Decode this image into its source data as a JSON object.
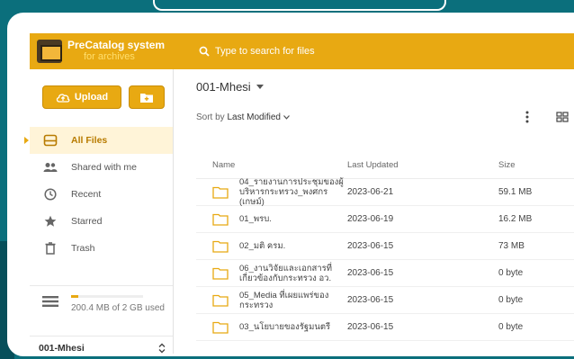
{
  "app": {
    "logo_title": "PreCatalog system",
    "logo_subtitle": "for archives",
    "search_placeholder": "Type to search for files"
  },
  "sidebar": {
    "upload_label": "Upload",
    "items": [
      {
        "label": "All Files",
        "icon": "drive-icon",
        "active": true
      },
      {
        "label": "Shared with me",
        "icon": "people-icon"
      },
      {
        "label": "Recent",
        "icon": "clock-icon"
      },
      {
        "label": "Starred",
        "icon": "star-icon"
      },
      {
        "label": "Trash",
        "icon": "trash-icon"
      }
    ],
    "storage": {
      "text": "200.4 MB of 2 GB used",
      "used_fraction": 0.1
    },
    "workspace": "001-Mhesi"
  },
  "main": {
    "breadcrumb": "001-Mhesi",
    "sort_prefix": "Sort by ",
    "sort_value": "Last Modified",
    "columns": {
      "name": "Name",
      "updated": "Last Updated",
      "size": "Size"
    },
    "files": [
      {
        "name": "04_รายงานการประชุมของผู้บริหารกระทรวง_พงศกร (เกษม์)",
        "date": "2023-06-21",
        "size": "59.1 MB"
      },
      {
        "name": "01_พรบ.",
        "date": "2023-06-19",
        "size": "16.2 MB"
      },
      {
        "name": "02_มติ ครม.",
        "date": "2023-06-15",
        "size": "73 MB"
      },
      {
        "name": "06_งานวิจัยและเอกสารที่เกี่ยวข้องกับกระทรวง อว.",
        "date": "2023-06-15",
        "size": "0 byte"
      },
      {
        "name": "05_Media ที่เผยแพร่ของกระทรวง",
        "date": "2023-06-15",
        "size": "0 byte"
      },
      {
        "name": "03_นโยบายของรัฐมนตรี",
        "date": "2023-06-15",
        "size": "0 byte"
      }
    ]
  },
  "colors": {
    "accent": "#e8a912",
    "background": "#0b6f7c",
    "active_bg": "#fff4d8"
  }
}
